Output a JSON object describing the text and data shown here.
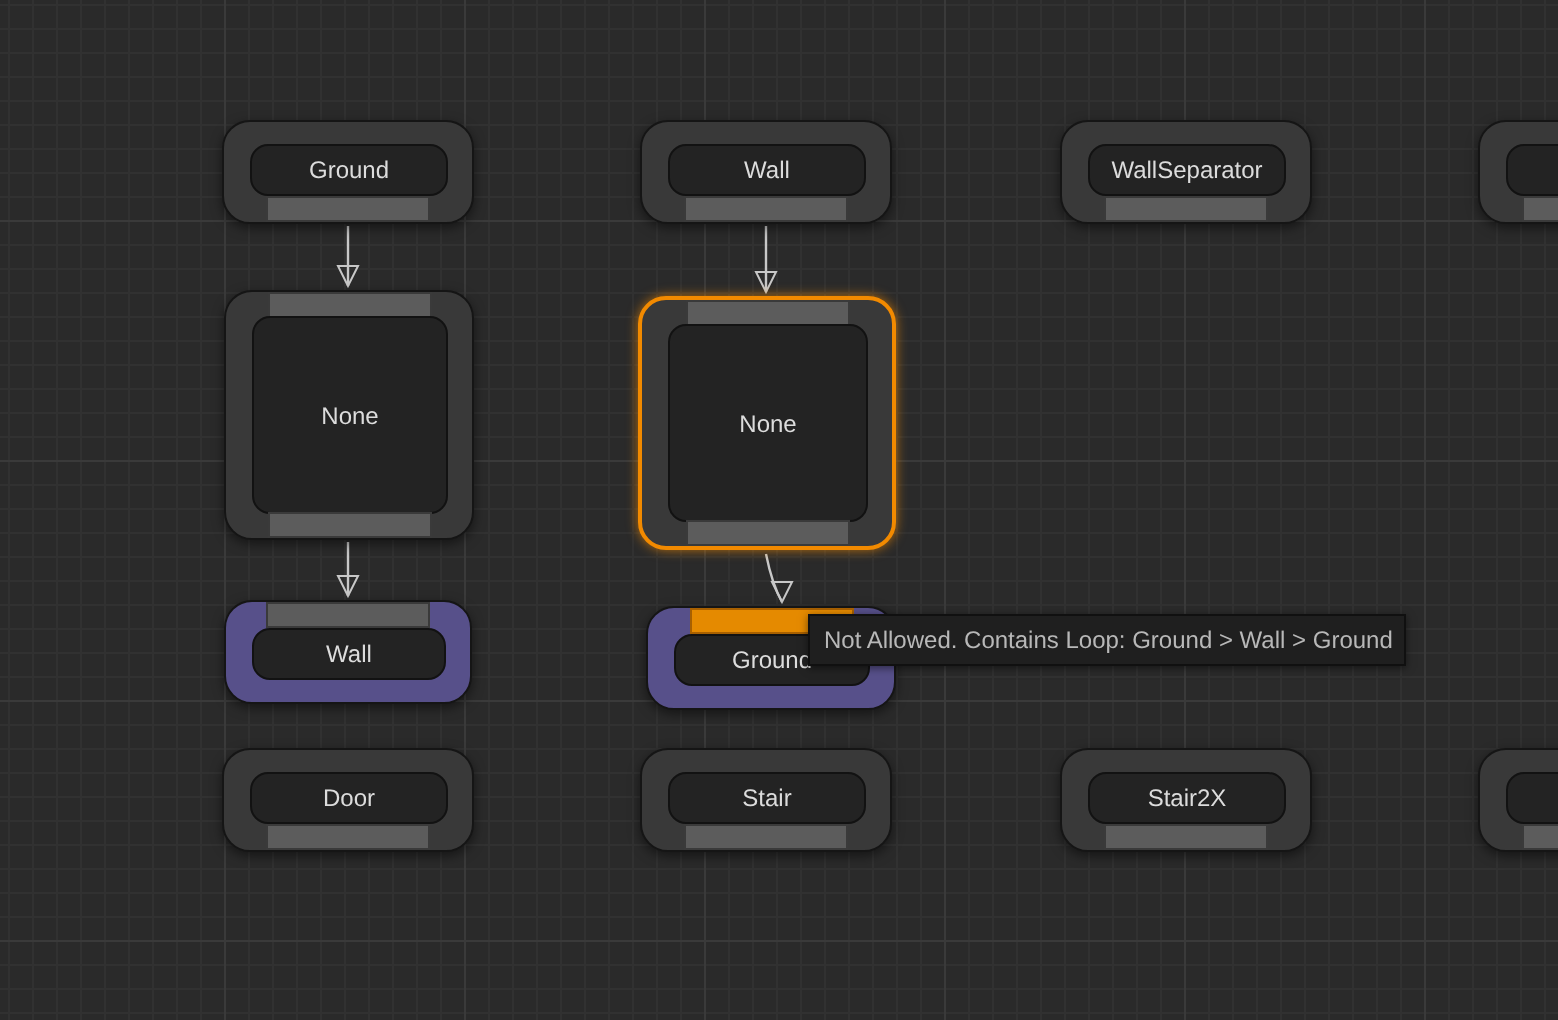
{
  "graph": {
    "nodes": [
      {
        "kind": "entry",
        "label": "Ground",
        "selected": false
      },
      {
        "kind": "entry",
        "label": "Wall",
        "selected": false
      },
      {
        "kind": "entry",
        "label": "WallSeparator",
        "selected": false
      },
      {
        "kind": "entry",
        "selected": false
      },
      {
        "kind": "group",
        "label": "None",
        "selected": false
      },
      {
        "kind": "group",
        "label": "None",
        "selected": true
      },
      {
        "kind": "leaf",
        "label": "Wall",
        "selected": false,
        "invalid": false
      },
      {
        "kind": "leaf",
        "label": "Ground",
        "selected": false,
        "invalid": true
      },
      {
        "kind": "entry",
        "label": "Door",
        "selected": false
      },
      {
        "kind": "entry",
        "label": "Stair",
        "selected": false
      },
      {
        "kind": "entry",
        "label": "Stair2X",
        "selected": false
      },
      {
        "kind": "entry",
        "selected": false
      }
    ]
  },
  "tooltip": {
    "text": "Not Allowed. Contains Loop: Ground > Wall > Ground"
  }
}
